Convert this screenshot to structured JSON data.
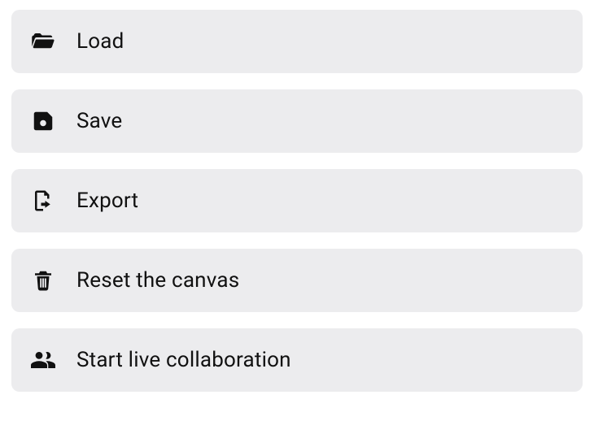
{
  "menu": {
    "items": [
      {
        "id": "load",
        "label": "Load",
        "icon": "folder-open-icon"
      },
      {
        "id": "save",
        "label": "Save",
        "icon": "save-icon"
      },
      {
        "id": "export",
        "label": "Export",
        "icon": "export-icon"
      },
      {
        "id": "reset",
        "label": "Reset the canvas",
        "icon": "trash-icon"
      },
      {
        "id": "collab",
        "label": "Start live collaboration",
        "icon": "people-icon"
      }
    ]
  }
}
